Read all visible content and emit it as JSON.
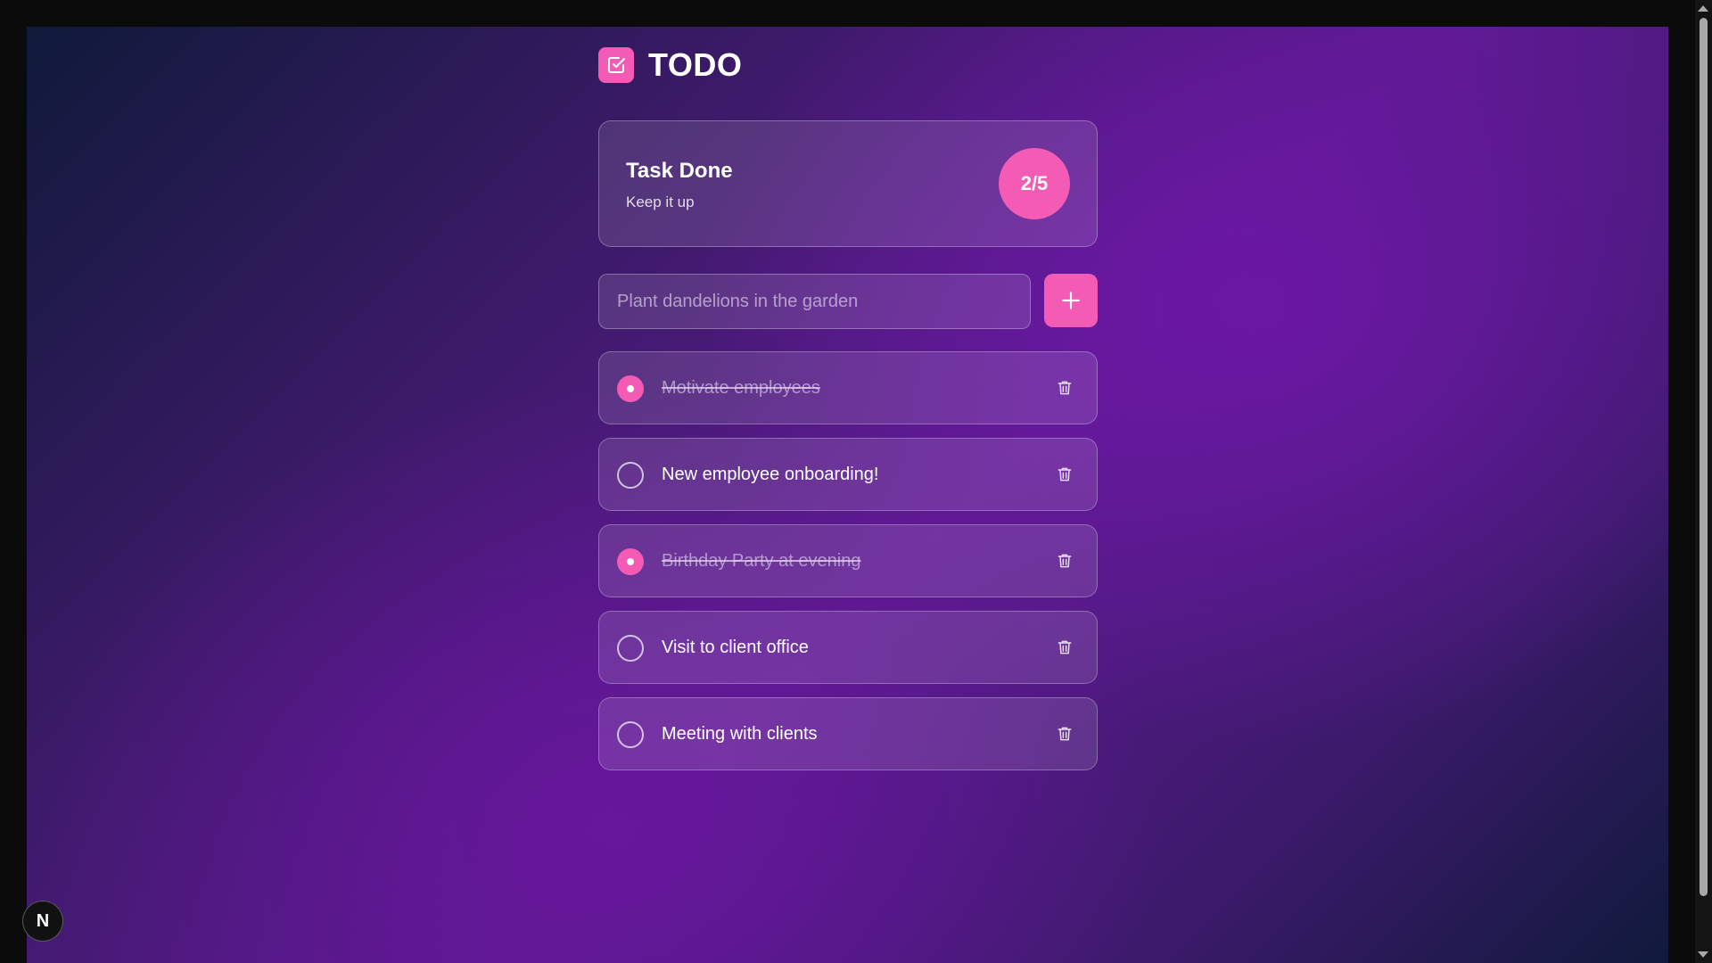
{
  "app": {
    "title": "TODO",
    "logo_icon": "checkbox-icon"
  },
  "summary": {
    "title": "Task Done",
    "subtitle": "Keep it up",
    "progress": "2/5",
    "completed": 2,
    "total": 5
  },
  "input": {
    "placeholder": "Plant dandelions in the garden",
    "value": "",
    "add_icon": "plus-icon"
  },
  "tasks": [
    {
      "text": "Motivate employees",
      "done": true
    },
    {
      "text": "New employee onboarding!",
      "done": false
    },
    {
      "text": "Birthday Party at evening",
      "done": true
    },
    {
      "text": "Visit to client office",
      "done": false
    },
    {
      "text": "Meeting with clients",
      "done": false
    }
  ],
  "dev_badge": {
    "label": "N"
  },
  "colors": {
    "accent": "#f35bb4",
    "background_mid": "#5b1a8e",
    "background_edge": "#0f1a3a"
  }
}
